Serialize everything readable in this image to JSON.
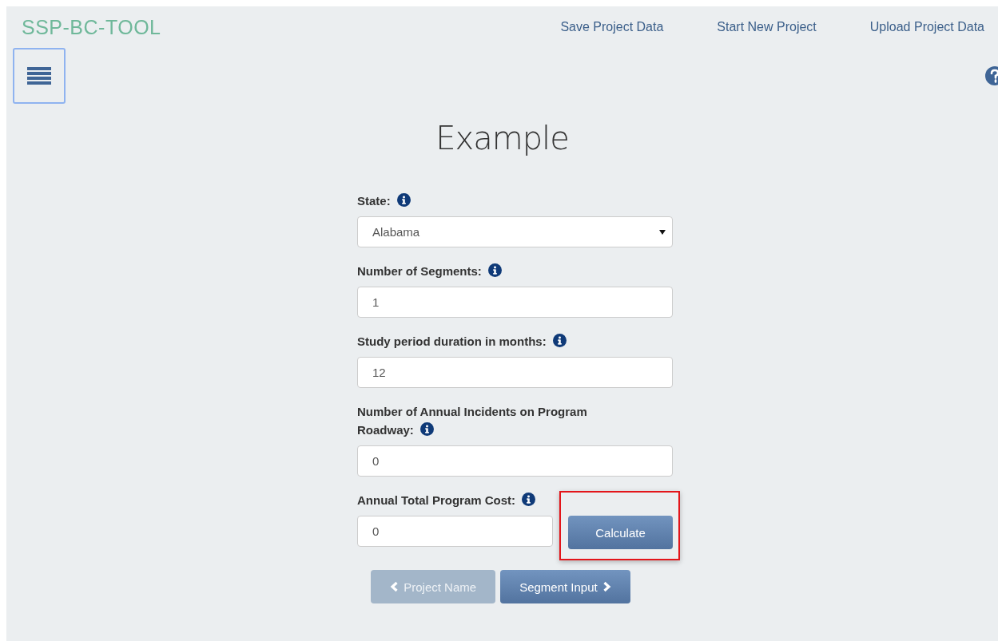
{
  "brand": "SSP-BC-TOOL",
  "nav_links": [
    "Save Project Data",
    "Start New Project",
    "Upload Project Data"
  ],
  "title": "Example",
  "fields": [
    {
      "label": "State:",
      "kind": "select",
      "value": "Alabama"
    },
    {
      "label": "Number of Segments:",
      "kind": "input",
      "value": "1"
    },
    {
      "label": "Study period duration in months:",
      "kind": "input",
      "value": "12"
    },
    {
      "label": "Number of Annual Incidents on Program Roadway:",
      "kind": "input",
      "value": "0"
    },
    {
      "label": "Annual Total Program Cost:",
      "kind": "input",
      "value": "0",
      "button": "Calculate",
      "highlighted": true
    }
  ],
  "pager": [
    {
      "label": "Project Name",
      "kind": "prev",
      "disabled": true
    },
    {
      "label": "Segment Input",
      "kind": "next",
      "disabled": false
    }
  ]
}
